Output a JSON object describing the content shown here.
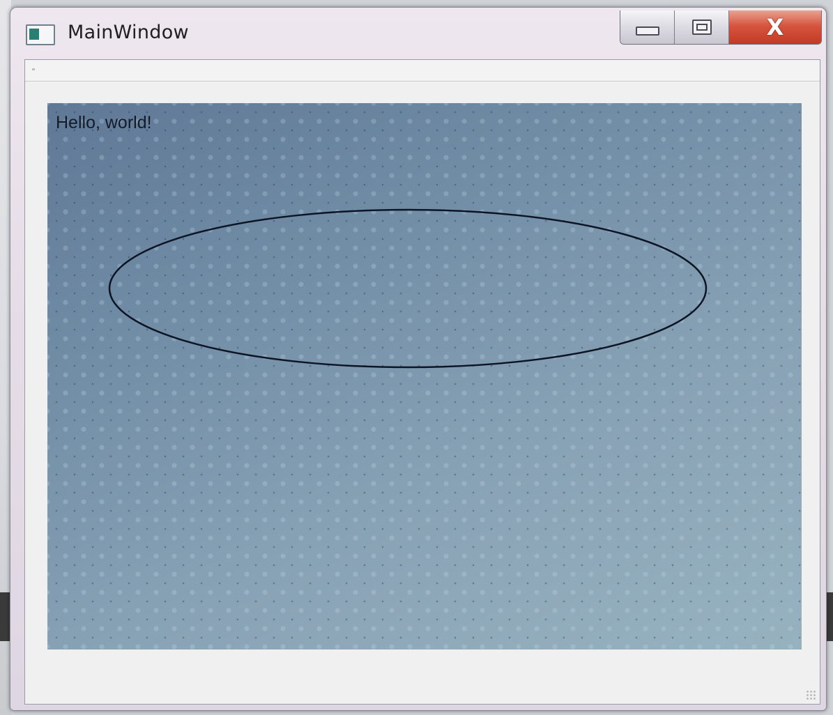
{
  "window": {
    "title": "MainWindow",
    "icon": "app-window-icon"
  },
  "caption_buttons": {
    "minimize_icon": "minimize-icon",
    "maximize_icon": "maximize-icon",
    "close_glyph": "X"
  },
  "canvas": {
    "text": "Hello, world!",
    "shape": "ellipse"
  },
  "colors": {
    "close_button": "#c84a33",
    "canvas_start": "#5f7896",
    "canvas_end": "#97b2bf",
    "ellipse_stroke": "#0d1524"
  }
}
